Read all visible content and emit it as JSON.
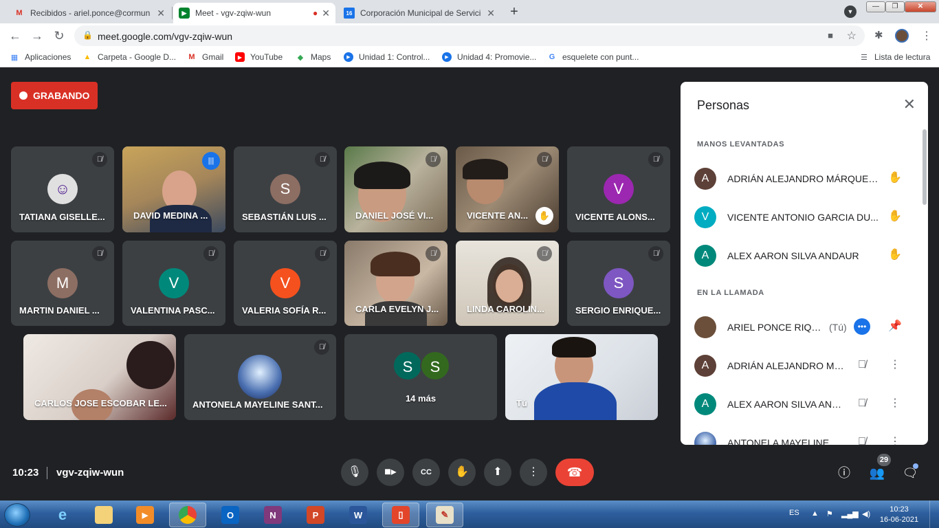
{
  "browser": {
    "tabs": [
      {
        "label": "Recibidos - ariel.ponce@cormun",
        "icon": "gmail-icon"
      },
      {
        "label": "Meet - vgv-zqiw-wun",
        "icon": "meet-icon"
      },
      {
        "label": "Corporación Municipal de Servici",
        "icon": "calendar-icon",
        "icon_text": "16"
      }
    ],
    "url": "meet.google.com/vgv-zqiw-wun",
    "bookmarks": [
      {
        "label": "Aplicaciones",
        "icon": "apps-grid-icon"
      },
      {
        "label": "Carpeta - Google D...",
        "icon": "drive-icon"
      },
      {
        "label": "Gmail",
        "icon": "gmail-icon"
      },
      {
        "label": "YouTube",
        "icon": "youtube-icon"
      },
      {
        "label": "Maps",
        "icon": "maps-icon"
      },
      {
        "label": "Unidad 1: Control...",
        "icon": "play-icon"
      },
      {
        "label": "Unidad 4: Promovie...",
        "icon": "play-icon"
      },
      {
        "label": "esquelete con punt...",
        "icon": "google-icon"
      }
    ],
    "reading_list": "Lista de lectura"
  },
  "meet": {
    "recording_label": "GRABANDO",
    "time": "10:23",
    "meeting_code": "vgv-zqiw-wun",
    "participants_badge": "29",
    "more_label": "14 más",
    "more_avatars": [
      "S",
      "S"
    ],
    "tiles": [
      {
        "name": "TATIANA GISELLE...",
        "type": "avatar-img"
      },
      {
        "name": "DAVID MEDINA ...",
        "type": "video"
      },
      {
        "name": "SEBASTIÁN LUIS ...",
        "type": "letter",
        "letter": "S",
        "color": "#8d6e63"
      },
      {
        "name": "DANIEL JOSÉ VI...",
        "type": "video"
      },
      {
        "name": "VICENTE AN...",
        "type": "video"
      },
      {
        "name": "VICENTE ALONS...",
        "type": "letter",
        "letter": "V",
        "color": "#9c27b0"
      },
      {
        "name": "MARTIN DANIEL ...",
        "type": "letter",
        "letter": "M",
        "color": "#8d6e63"
      },
      {
        "name": "VALENTINA PASC...",
        "type": "letter",
        "letter": "V",
        "color": "#00897b"
      },
      {
        "name": "VALERIA SOFÍA R...",
        "type": "letter",
        "letter": "V",
        "color": "#f4511e"
      },
      {
        "name": "CARLA EVELYN J...",
        "type": "video"
      },
      {
        "name": "LINDA CAROLIN...",
        "type": "video"
      },
      {
        "name": "SERGIO ENRIQUE...",
        "type": "letter",
        "letter": "S",
        "color": "#7e57c2"
      },
      {
        "name": "CARLOS JOSE ESCOBAR LE...",
        "type": "video"
      },
      {
        "name": "ANTONELA MAYELINE SANT...",
        "type": "avatar-img"
      },
      {
        "name": "Tú",
        "type": "video"
      }
    ]
  },
  "people_panel": {
    "title": "Personas",
    "raised_hands_heading": "MANOS LEVANTADAS",
    "raised_hands": [
      {
        "name": "ADRIÁN ALEJANDRO MÁRQUEZ...",
        "letter": "A",
        "color": "#5d4037"
      },
      {
        "name": "VICENTE ANTONIO GARCIA DU...",
        "letter": "V",
        "color": "#00acc1"
      },
      {
        "name": "ALEX AARON SILVA ANDAUR",
        "letter": "A",
        "color": "#00897b"
      }
    ],
    "in_call_heading": "EN LA LLAMADA",
    "in_call": [
      {
        "name": "ARIEL PONCE RIQUE...",
        "suffix": "(Tú)",
        "letter": "",
        "color": "#6b4f3a"
      },
      {
        "name": "ADRIÁN ALEJANDRO MÁ...",
        "letter": "A",
        "color": "#5d4037"
      },
      {
        "name": "ALEX AARON SILVA AND...",
        "letter": "A",
        "color": "#00897b"
      },
      {
        "name": "ANTONELA MAYELINE SA...",
        "letter": "",
        "color": "#3f51b5"
      }
    ]
  },
  "taskbar": {
    "lang": "ES",
    "time": "10:23",
    "date": "16-06-2021"
  }
}
